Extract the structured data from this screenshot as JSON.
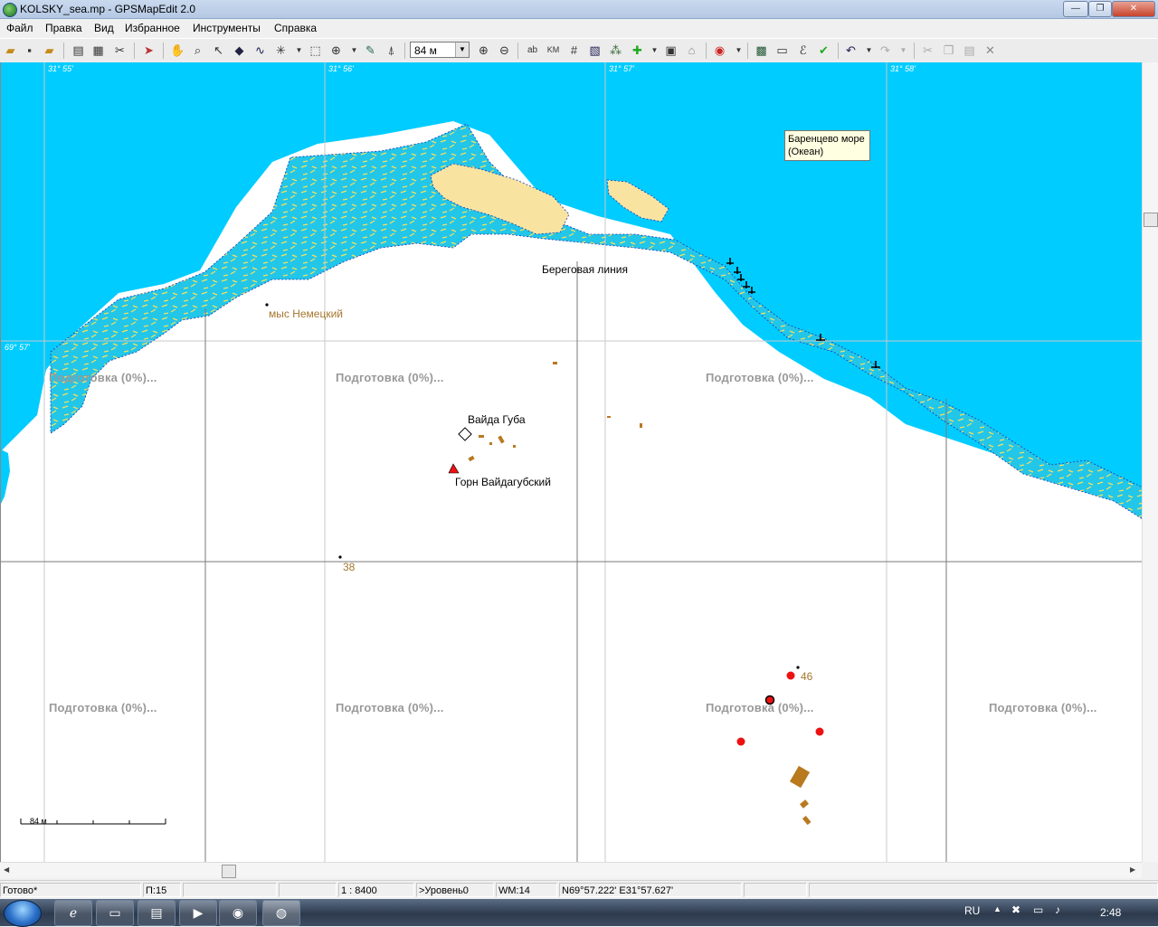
{
  "window": {
    "title": "KOLSKY_sea.mp - GPSMapEdit 2.0",
    "buttons": [
      "—",
      "❐",
      "✕"
    ]
  },
  "menu": [
    "Файл",
    "Правка",
    "Вид",
    "Избранное",
    "Инструменты",
    "Справка"
  ],
  "toolbar": {
    "scale_value": "84 м"
  },
  "map": {
    "grid_labels": {
      "lon": [
        "31° 55'",
        "31° 56'",
        "31° 57'",
        "31° 58'"
      ],
      "lat": "69° 57'"
    },
    "tooltip": {
      "line1": "Баренцево море",
      "line2": "(Океан)"
    },
    "labels": {
      "coastline": "Береговая линия",
      "cape": "мыс Немецкий",
      "bay": "Вайда Губа",
      "mountain": "Горн Вайдагубский",
      "point38": "38",
      "point46": "46"
    },
    "preparing": [
      "Подготовка (0%)...",
      "Подготовка (0%)...",
      "Подготовка (0%)...",
      "Подготовка (0%)...",
      "Подготовка (0%)...",
      "Подготовка (0%)...",
      "Подготовка (0%)..."
    ],
    "scalebar_label": "84 м",
    "colors": {
      "sea": "#00ccff",
      "land": "#ffffff",
      "island": "#f8e4a0",
      "shoal": "#20c8e8",
      "marker_red": "#ee1111",
      "building_brown": "#b8791f"
    }
  },
  "status": {
    "ready": "Готово*",
    "p": "П:15",
    "scale": "1 : 8400",
    "level": ">Уровень0",
    "wm": "WM:14",
    "coords": "N69°57.222' E31°57.627'"
  },
  "taskbar": {
    "lang": "RU",
    "time": "2:48"
  }
}
